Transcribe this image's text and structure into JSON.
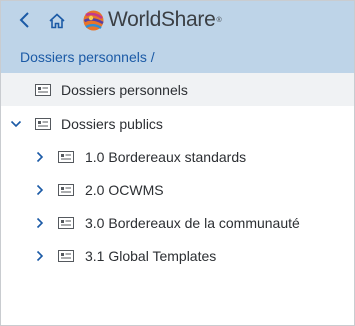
{
  "header": {
    "brand": "WorldShare",
    "brand_mark": "®",
    "breadcrumb": {
      "item": "Dossiers personnels",
      "separator": "/"
    },
    "back_icon": "chevron-left-icon",
    "home_icon": "home-icon",
    "logo_icon": "oclc-globe-icon"
  },
  "tree": {
    "items": [
      {
        "label": "Dossiers personnels",
        "selected": true,
        "expander": "none"
      },
      {
        "label": "Dossiers publics",
        "expander": "expanded"
      },
      {
        "label": "1.0 Bordereaux standards",
        "expander": "collapsed"
      },
      {
        "label": "2.0 OCWMS",
        "expander": "collapsed"
      },
      {
        "label": "3.0 Bordereaux de la communauté",
        "expander": "collapsed"
      },
      {
        "label": "3.1 Global Templates",
        "expander": "collapsed"
      }
    ]
  },
  "colors": {
    "header_bg": "#bed4e8",
    "link": "#1b5aa6",
    "selected_bg": "#f0f2f4"
  }
}
